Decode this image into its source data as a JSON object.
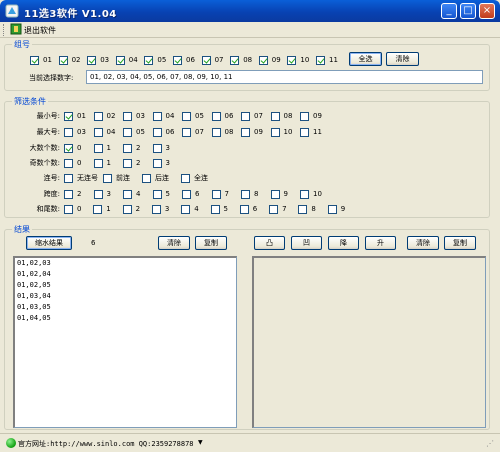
{
  "window": {
    "title": "11选3软件 V1.04",
    "minimize_glyph": "_",
    "maximize_glyph": "□",
    "close_glyph": "×"
  },
  "menu": {
    "exit_label": "退出软件"
  },
  "group_section": {
    "title": "组号",
    "numbers": [
      {
        "label": "01",
        "checked": true
      },
      {
        "label": "02",
        "checked": true
      },
      {
        "label": "03",
        "checked": true
      },
      {
        "label": "04",
        "checked": true
      },
      {
        "label": "05",
        "checked": true
      },
      {
        "label": "06",
        "checked": true
      },
      {
        "label": "07",
        "checked": true
      },
      {
        "label": "08",
        "checked": true
      },
      {
        "label": "09",
        "checked": true
      },
      {
        "label": "10",
        "checked": true
      },
      {
        "label": "11",
        "checked": true
      }
    ],
    "select_all_label": "全选",
    "clear_label": "清除",
    "current_label": "当前选择数字:",
    "current_value": "01, 02, 03, 04, 05, 06, 07, 08, 09, 10, 11"
  },
  "filter_section": {
    "title": "筛选条件",
    "rows": [
      {
        "label": "最小号:",
        "options": [
          {
            "label": "01",
            "checked": true
          },
          {
            "label": "02"
          },
          {
            "label": "03"
          },
          {
            "label": "04"
          },
          {
            "label": "05"
          },
          {
            "label": "06"
          },
          {
            "label": "07"
          },
          {
            "label": "08"
          },
          {
            "label": "09"
          }
        ]
      },
      {
        "label": "最大号:",
        "options": [
          {
            "label": "03"
          },
          {
            "label": "04"
          },
          {
            "label": "05"
          },
          {
            "label": "06"
          },
          {
            "label": "07"
          },
          {
            "label": "08"
          },
          {
            "label": "09"
          },
          {
            "label": "10"
          },
          {
            "label": "11"
          }
        ]
      },
      {
        "label": "大数个数:",
        "options": [
          {
            "label": "0",
            "checked": true
          },
          {
            "label": "1"
          },
          {
            "label": "2"
          },
          {
            "label": "3"
          }
        ]
      },
      {
        "label": "奇数个数:",
        "options": [
          {
            "label": "0"
          },
          {
            "label": "1"
          },
          {
            "label": "2"
          },
          {
            "label": "3"
          }
        ]
      },
      {
        "label": "连号:",
        "options": [
          {
            "label": "无连号"
          },
          {
            "label": "前连"
          },
          {
            "label": "后连"
          },
          {
            "label": "全连"
          }
        ]
      },
      {
        "label": "跨度:",
        "options": [
          {
            "label": "2"
          },
          {
            "label": "3"
          },
          {
            "label": "4"
          },
          {
            "label": "5"
          },
          {
            "label": "6"
          },
          {
            "label": "7"
          },
          {
            "label": "8"
          },
          {
            "label": "9"
          },
          {
            "label": "10"
          }
        ]
      },
      {
        "label": "和尾数:",
        "options": [
          {
            "label": "0"
          },
          {
            "label": "1"
          },
          {
            "label": "2"
          },
          {
            "label": "3"
          },
          {
            "label": "4"
          },
          {
            "label": "5"
          },
          {
            "label": "6"
          },
          {
            "label": "7"
          },
          {
            "label": "8"
          },
          {
            "label": "9"
          }
        ]
      }
    ]
  },
  "result_section": {
    "title": "结果",
    "shrink_label": "缩水结果",
    "count": "6",
    "clear_label": "清除",
    "copy_label": "复制",
    "results": [
      "01,02,03",
      "01,02,04",
      "01,02,05",
      "01,03,04",
      "01,03,05",
      "01,04,05"
    ],
    "right_buttons": [
      "凸",
      "凹",
      "降",
      "升"
    ],
    "right_clear_label": "清除",
    "right_copy_label": "复制"
  },
  "status": {
    "text": "官方网址:http://www.sinlo.com QQ:2359278878",
    "arrow": "▼",
    "grip": "⋰"
  }
}
